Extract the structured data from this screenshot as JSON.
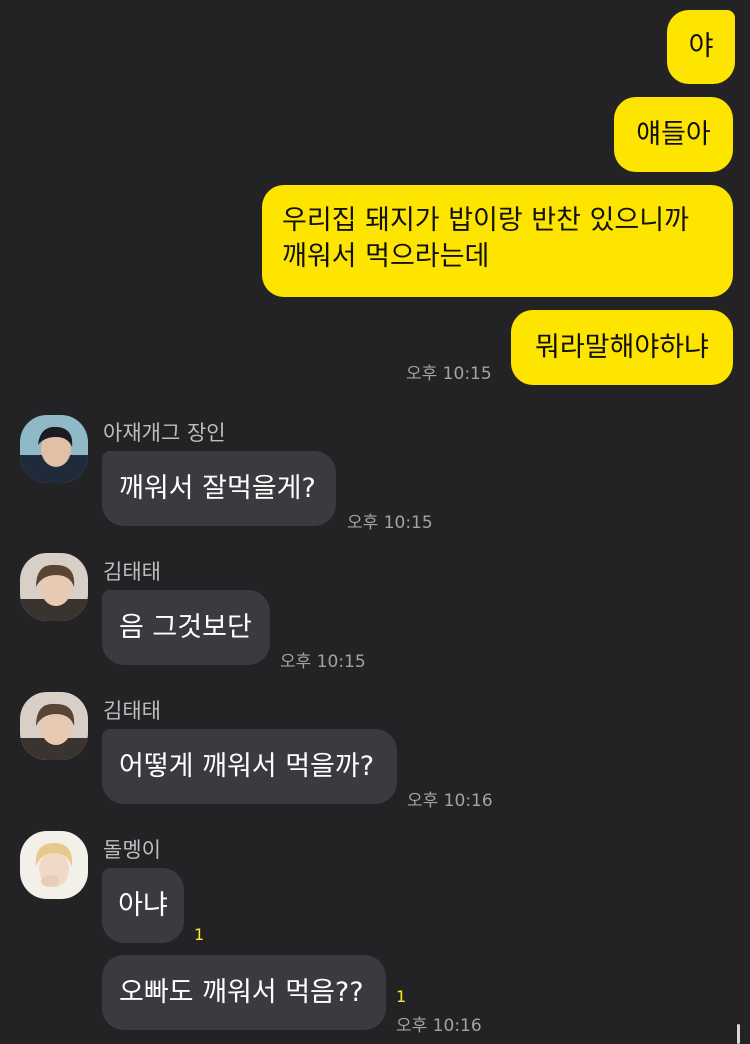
{
  "outgoing": [
    {
      "text": "야"
    },
    {
      "text": "얘들아"
    },
    {
      "lines": [
        "우리집 돼지가 밥이랑 반찬 있으니까",
        "깨워서 먹으라는데"
      ]
    },
    {
      "text": "뭐라말해야하냐",
      "time": "오후 10:15"
    }
  ],
  "incoming": [
    {
      "sender": "아재개그 장인",
      "text": "깨워서 잘먹을게?",
      "time": "오후 10:15"
    },
    {
      "sender": "김태태",
      "text": "음 그것보단",
      "time": "오후 10:15"
    },
    {
      "sender": "김태태",
      "text": "어떻게 깨워서 먹을까?",
      "time": "오후 10:16"
    },
    {
      "sender": "돌멩이",
      "text": "아냐",
      "unread": "1"
    },
    {
      "text": "오빠도 깨워서 먹음??",
      "unread": "1",
      "time": "오후 10:16"
    }
  ],
  "colors": {
    "background": "#232325",
    "outgoing_bubble": "#fee500",
    "incoming_bubble": "#3b3a3f",
    "unread_count": "#ffe52e"
  }
}
